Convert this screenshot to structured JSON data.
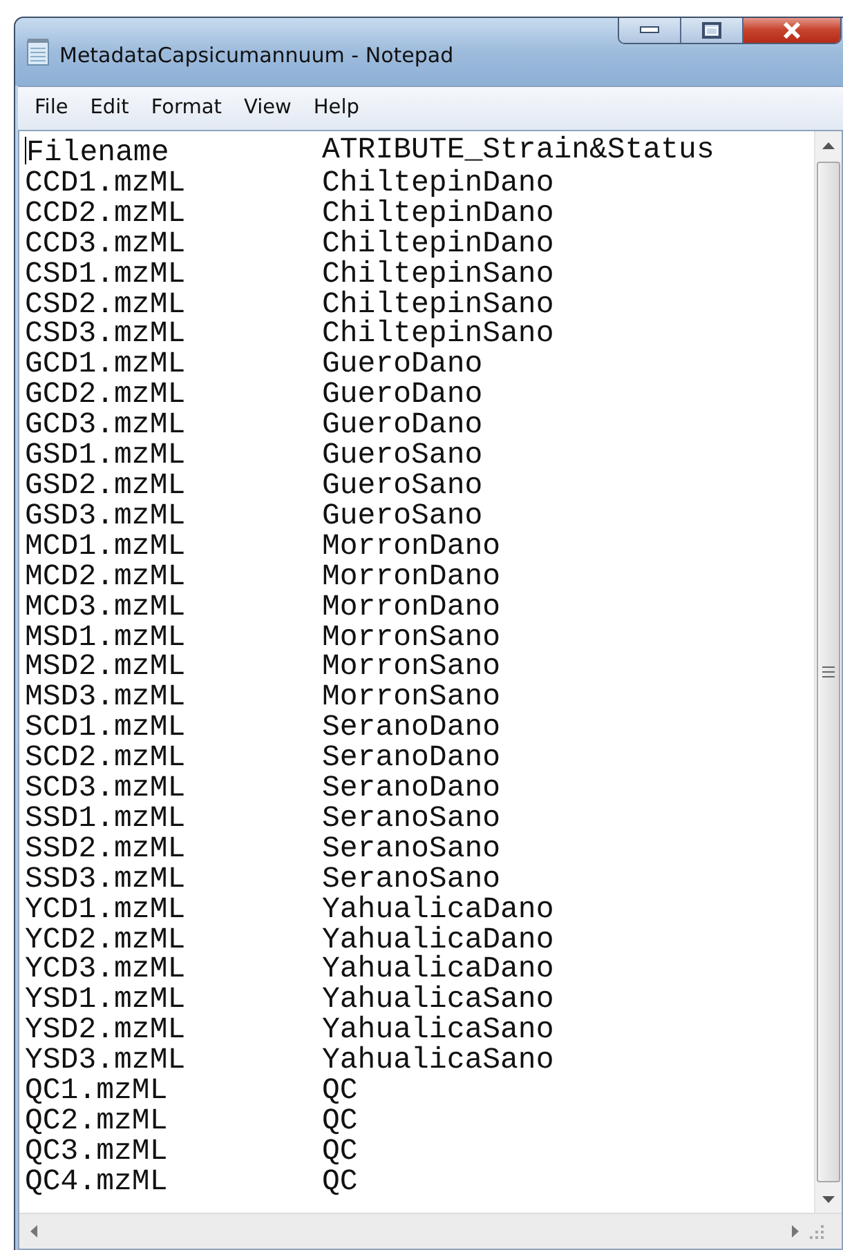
{
  "window": {
    "title": "MetadataCapsicumannuum - Notepad"
  },
  "menu": [
    "File",
    "Edit",
    "Format",
    "View",
    "Help"
  ],
  "lines": [
    {
      "column_1": "Filename",
      "column_2": "ATRIBUTE_Strain&Status"
    },
    {
      "column_1": "CCD1.mzML",
      "column_2": "ChiltepinDano"
    },
    {
      "column_1": "CCD2.mzML",
      "column_2": "ChiltepinDano"
    },
    {
      "column_1": "CCD3.mzML",
      "column_2": "ChiltepinDano"
    },
    {
      "column_1": "CSD1.mzML",
      "column_2": "ChiltepinSano"
    },
    {
      "column_1": "CSD2.mzML",
      "column_2": "ChiltepinSano"
    },
    {
      "column_1": "CSD3.mzML",
      "column_2": "ChiltepinSano"
    },
    {
      "column_1": "GCD1.mzML",
      "column_2": "GueroDano"
    },
    {
      "column_1": "GCD2.mzML",
      "column_2": "GueroDano"
    },
    {
      "column_1": "GCD3.mzML",
      "column_2": "GueroDano"
    },
    {
      "column_1": "GSD1.mzML",
      "column_2": "GueroSano"
    },
    {
      "column_1": "GSD2.mzML",
      "column_2": "GueroSano"
    },
    {
      "column_1": "GSD3.mzML",
      "column_2": "GueroSano"
    },
    {
      "column_1": "MCD1.mzML",
      "column_2": "MorronDano"
    },
    {
      "column_1": "MCD2.mzML",
      "column_2": "MorronDano"
    },
    {
      "column_1": "MCD3.mzML",
      "column_2": "MorronDano"
    },
    {
      "column_1": "MSD1.mzML",
      "column_2": "MorronSano"
    },
    {
      "column_1": "MSD2.mzML",
      "column_2": "MorronSano"
    },
    {
      "column_1": "MSD3.mzML",
      "column_2": "MorronSano"
    },
    {
      "column_1": "SCD1.mzML",
      "column_2": "SeranoDano"
    },
    {
      "column_1": "SCD2.mzML",
      "column_2": "SeranoDano"
    },
    {
      "column_1": "SCD3.mzML",
      "column_2": "SeranoDano"
    },
    {
      "column_1": "SSD1.mzML",
      "column_2": "SeranoSano"
    },
    {
      "column_1": "SSD2.mzML",
      "column_2": "SeranoSano"
    },
    {
      "column_1": "SSD3.mzML",
      "column_2": "SeranoSano"
    },
    {
      "column_1": "YCD1.mzML",
      "column_2": "YahualicaDano"
    },
    {
      "column_1": "YCD2.mzML",
      "column_2": "YahualicaDano"
    },
    {
      "column_1": "YCD3.mzML",
      "column_2": "YahualicaDano"
    },
    {
      "column_1": "YSD1.mzML",
      "column_2": "YahualicaSano"
    },
    {
      "column_1": "YSD2.mzML",
      "column_2": "YahualicaSano"
    },
    {
      "column_1": "YSD3.mzML",
      "column_2": "YahualicaSano"
    },
    {
      "column_1": "QC1.mzML",
      "column_2": "QC"
    },
    {
      "column_1": "QC2.mzML",
      "column_2": "QC"
    },
    {
      "column_1": "QC3.mzML",
      "column_2": "QC"
    },
    {
      "column_1": "QC4.mzML",
      "column_2": "QC"
    }
  ]
}
